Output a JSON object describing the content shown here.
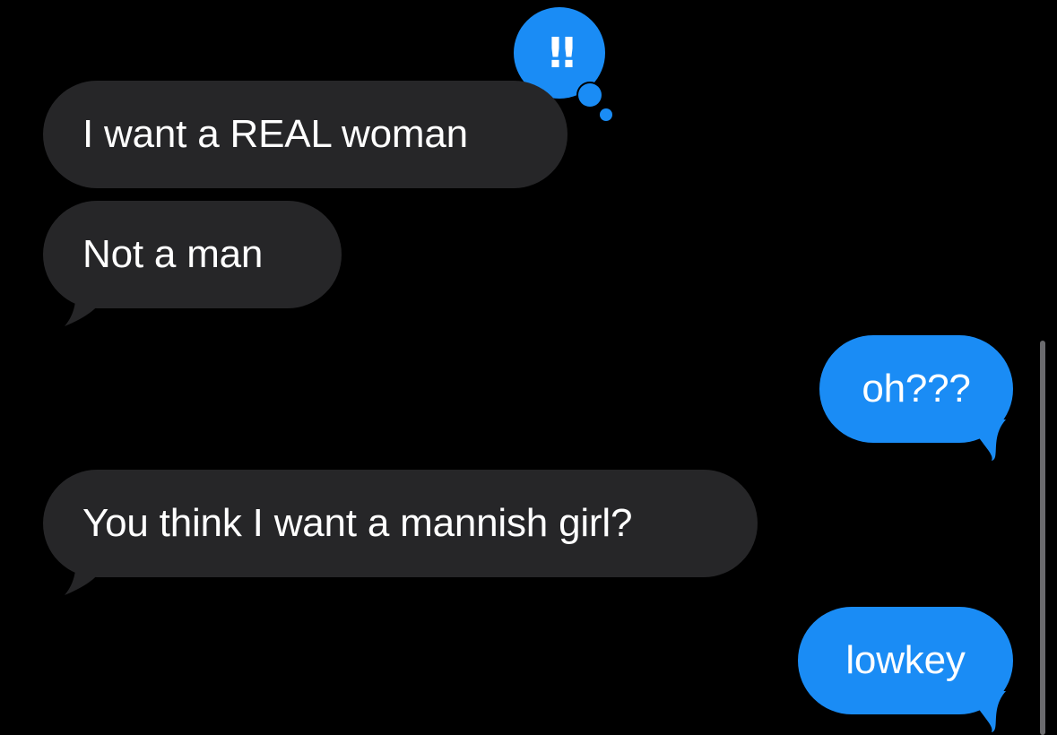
{
  "messages": [
    {
      "direction": "incoming",
      "text": "I want a REAL woman"
    },
    {
      "direction": "incoming",
      "text": "Not a man"
    },
    {
      "direction": "outgoing",
      "text": "oh???"
    },
    {
      "direction": "incoming",
      "text": "You think I want a mannish girl?"
    },
    {
      "direction": "outgoing",
      "text": "lowkey"
    }
  ],
  "reaction": {
    "on_message": 0,
    "glyph": "!!",
    "icon": "double-exclamation-tapback-icon"
  },
  "colors": {
    "background": "#000000",
    "incoming_bubble": "#262628",
    "outgoing_bubble": "#1a8cf5",
    "text": "#ffffff"
  }
}
